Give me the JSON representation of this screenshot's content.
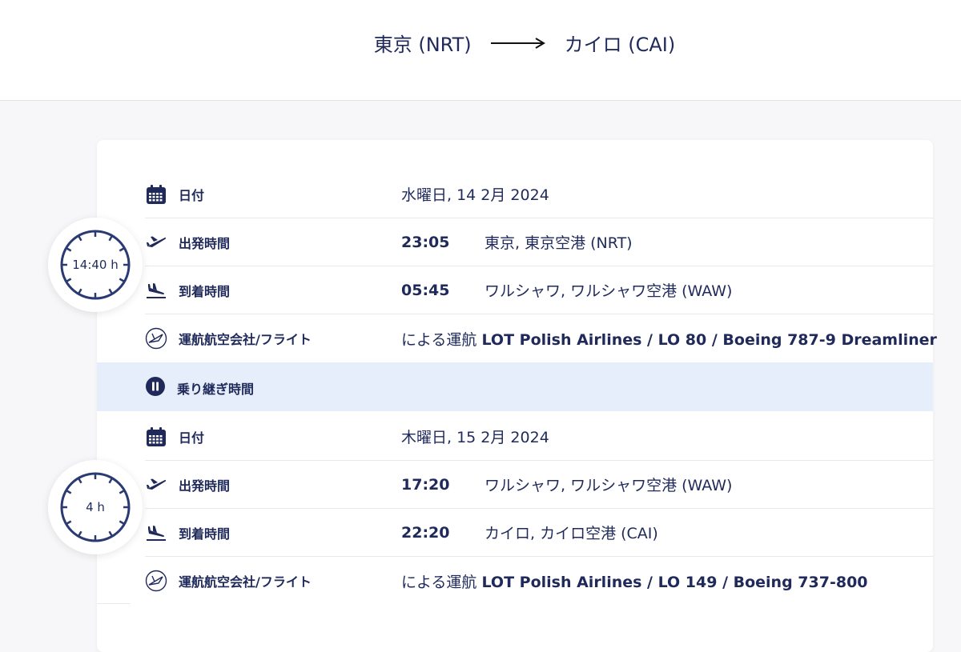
{
  "route": {
    "origin": "東京 (NRT)",
    "destination": "カイロ (CAI)"
  },
  "segments": [
    {
      "duration": "14:40 h",
      "date_label": "日付",
      "date": "水曜日, 14 2月 2024",
      "departure_label": "出発時間",
      "departure_time": "23:05",
      "departure_place": "東京, 東京空港 (NRT)",
      "arrival_label": "到着時間",
      "arrival_time": "05:45",
      "arrival_place": "ワルシャワ, ワルシャワ空港 (WAW)",
      "carrier_label": "運航航空会社/フライト",
      "carrier_prefix": "による運航",
      "carrier_info": "LOT Polish Airlines / LO 80 / Boeing 787-9 Dreamliner"
    },
    {
      "duration": "4 h",
      "date_label": "日付",
      "date": "木曜日, 15 2月 2024",
      "departure_label": "出発時間",
      "departure_time": "17:20",
      "departure_place": "ワルシャワ, ワルシャワ空港 (WAW)",
      "arrival_label": "到着時間",
      "arrival_time": "22:20",
      "arrival_place": "カイロ, カイロ空港 (CAI)",
      "carrier_label": "運航航空会社/フライト",
      "carrier_prefix": "による運航",
      "carrier_info": "LOT Polish Airlines / LO 149 / Boeing 737-800"
    }
  ],
  "layover": {
    "label": "乗り継ぎ時間"
  },
  "colors": {
    "primary": "#1f2a5a",
    "layover_bg": "#e6eefb",
    "divider": "#e8e8ee"
  },
  "icons": {
    "date": "calendar-icon",
    "departure": "plane-departure-icon",
    "arrival": "plane-arrival-icon",
    "carrier": "airline-logo-icon",
    "layover": "pause-icon",
    "duration": "clock-icon"
  }
}
